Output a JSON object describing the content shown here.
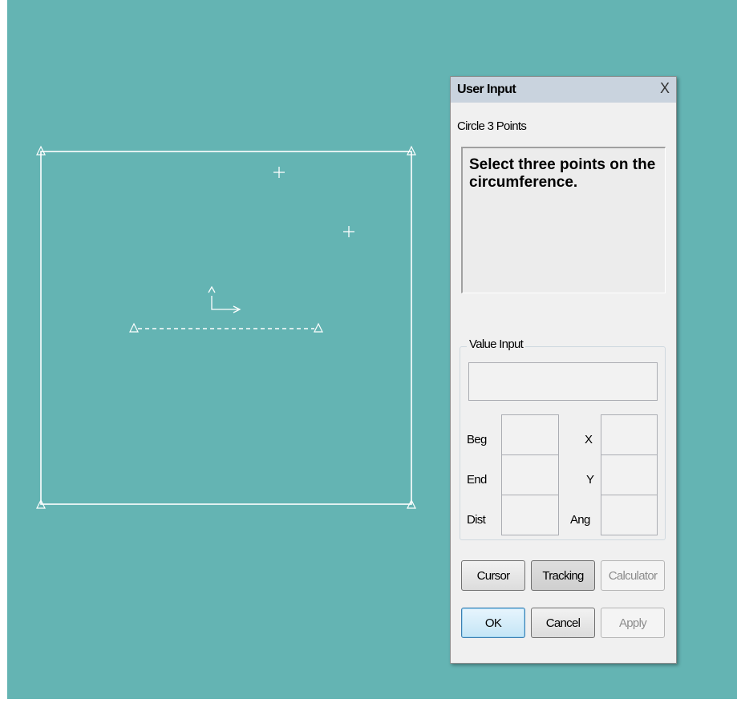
{
  "dialog": {
    "title": "User Input",
    "close_label": "X",
    "command_name": "Circle 3 Points",
    "prompt": "Select three points on the circumference.",
    "value_input": {
      "legend": "Value Input",
      "main_value": "",
      "labels": {
        "beg": "Beg",
        "end": "End",
        "dist": "Dist",
        "x": "X",
        "y": "Y",
        "ang": "Ang"
      },
      "values": {
        "beg": "",
        "end": "",
        "dist": "",
        "x": "",
        "y": "",
        "ang": ""
      }
    },
    "buttons": {
      "cursor": "Cursor",
      "tracking": "Tracking",
      "calculator": "Calculator",
      "ok": "OK",
      "cancel": "Cancel",
      "apply": "Apply"
    }
  },
  "canvas": {
    "background_color": "#64b4b3",
    "stroke_color": "#ffffff",
    "items": [
      "rectangle-outline",
      "vertex-markers",
      "dashed-line",
      "point-markers",
      "ucs-axis-icon"
    ]
  }
}
